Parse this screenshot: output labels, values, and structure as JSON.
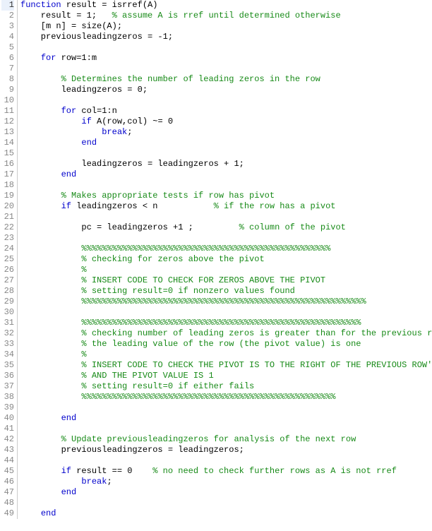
{
  "lines": [
    {
      "n": 1,
      "active": true,
      "seg": [
        {
          "t": "function",
          "c": "kw"
        },
        {
          "t": " result = isrref(A)",
          "c": "txt"
        }
      ]
    },
    {
      "n": 2,
      "seg": [
        {
          "t": "    result = 1;   ",
          "c": "txt"
        },
        {
          "t": "% assume A is rref until determined otherwise",
          "c": "com"
        }
      ]
    },
    {
      "n": 3,
      "seg": [
        {
          "t": "    [m n] = size(A);",
          "c": "txt"
        }
      ]
    },
    {
      "n": 4,
      "seg": [
        {
          "t": "    previousleadingzeros = -1;",
          "c": "txt"
        }
      ]
    },
    {
      "n": 5,
      "seg": [
        {
          "t": "",
          "c": "txt"
        }
      ]
    },
    {
      "n": 6,
      "seg": [
        {
          "t": "    ",
          "c": "txt"
        },
        {
          "t": "for",
          "c": "kw"
        },
        {
          "t": " row=1:m",
          "c": "txt"
        }
      ]
    },
    {
      "n": 7,
      "seg": [
        {
          "t": "",
          "c": "txt"
        }
      ]
    },
    {
      "n": 8,
      "seg": [
        {
          "t": "        ",
          "c": "txt"
        },
        {
          "t": "% Determines the number of leading zeros in the row",
          "c": "com"
        }
      ]
    },
    {
      "n": 9,
      "seg": [
        {
          "t": "        leadingzeros = 0;",
          "c": "txt"
        }
      ]
    },
    {
      "n": 10,
      "seg": [
        {
          "t": "",
          "c": "txt"
        }
      ]
    },
    {
      "n": 11,
      "seg": [
        {
          "t": "        ",
          "c": "txt"
        },
        {
          "t": "for",
          "c": "kw"
        },
        {
          "t": " col=1:n",
          "c": "txt"
        }
      ]
    },
    {
      "n": 12,
      "seg": [
        {
          "t": "            ",
          "c": "txt"
        },
        {
          "t": "if",
          "c": "kw"
        },
        {
          "t": " A(row,col) ~= 0",
          "c": "txt"
        }
      ]
    },
    {
      "n": 13,
      "seg": [
        {
          "t": "                ",
          "c": "txt"
        },
        {
          "t": "break",
          "c": "kw"
        },
        {
          "t": ";",
          "c": "txt"
        }
      ]
    },
    {
      "n": 14,
      "seg": [
        {
          "t": "            ",
          "c": "txt"
        },
        {
          "t": "end",
          "c": "kw"
        }
      ]
    },
    {
      "n": 15,
      "seg": [
        {
          "t": "",
          "c": "txt"
        }
      ]
    },
    {
      "n": 16,
      "seg": [
        {
          "t": "            leadingzeros = leadingzeros + 1;",
          "c": "txt"
        }
      ]
    },
    {
      "n": 17,
      "seg": [
        {
          "t": "        ",
          "c": "txt"
        },
        {
          "t": "end",
          "c": "kw"
        }
      ]
    },
    {
      "n": 18,
      "seg": [
        {
          "t": "",
          "c": "txt"
        }
      ]
    },
    {
      "n": 19,
      "seg": [
        {
          "t": "        ",
          "c": "txt"
        },
        {
          "t": "% Makes appropriate tests if row has pivot",
          "c": "com"
        }
      ]
    },
    {
      "n": 20,
      "seg": [
        {
          "t": "        ",
          "c": "txt"
        },
        {
          "t": "if",
          "c": "kw"
        },
        {
          "t": " leadingzeros < n           ",
          "c": "txt"
        },
        {
          "t": "% if the row has a pivot",
          "c": "com"
        }
      ]
    },
    {
      "n": 21,
      "seg": [
        {
          "t": "",
          "c": "txt"
        }
      ]
    },
    {
      "n": 22,
      "seg": [
        {
          "t": "            pc = leadingzeros +1 ;         ",
          "c": "txt"
        },
        {
          "t": "% column of the pivot",
          "c": "com"
        }
      ]
    },
    {
      "n": 23,
      "seg": [
        {
          "t": "",
          "c": "txt"
        }
      ]
    },
    {
      "n": 24,
      "seg": [
        {
          "t": "            ",
          "c": "txt"
        },
        {
          "t": "%%%%%%%%%%%%%%%%%%%%%%%%%%%%%%%%%%%%%%%%%%%%%%%%%",
          "c": "com"
        }
      ]
    },
    {
      "n": 25,
      "seg": [
        {
          "t": "            ",
          "c": "txt"
        },
        {
          "t": "% checking for zeros above the pivot",
          "c": "com"
        }
      ]
    },
    {
      "n": 26,
      "seg": [
        {
          "t": "            ",
          "c": "txt"
        },
        {
          "t": "%",
          "c": "com"
        }
      ]
    },
    {
      "n": 27,
      "seg": [
        {
          "t": "            ",
          "c": "txt"
        },
        {
          "t": "% INSERT CODE TO CHECK FOR ZEROS ABOVE THE PIVOT",
          "c": "com"
        }
      ]
    },
    {
      "n": 28,
      "seg": [
        {
          "t": "            ",
          "c": "txt"
        },
        {
          "t": "% setting result=0 if nonzero values found",
          "c": "com"
        }
      ]
    },
    {
      "n": 29,
      "seg": [
        {
          "t": "            ",
          "c": "txt"
        },
        {
          "t": "%%%%%%%%%%%%%%%%%%%%%%%%%%%%%%%%%%%%%%%%%%%%%%%%%%%%%%%%",
          "c": "com"
        }
      ]
    },
    {
      "n": 30,
      "seg": [
        {
          "t": "",
          "c": "txt"
        }
      ]
    },
    {
      "n": 31,
      "seg": [
        {
          "t": "            ",
          "c": "txt"
        },
        {
          "t": "%%%%%%%%%%%%%%%%%%%%%%%%%%%%%%%%%%%%%%%%%%%%%%%%%%%%%%%",
          "c": "com"
        }
      ]
    },
    {
      "n": 32,
      "seg": [
        {
          "t": "            ",
          "c": "txt"
        },
        {
          "t": "% checking number of leading zeros is greater than for the previous row and",
          "c": "com"
        }
      ]
    },
    {
      "n": 33,
      "seg": [
        {
          "t": "            ",
          "c": "txt"
        },
        {
          "t": "% the leading value of the row (the pivot value) is one",
          "c": "com"
        }
      ]
    },
    {
      "n": 34,
      "seg": [
        {
          "t": "            ",
          "c": "txt"
        },
        {
          "t": "%",
          "c": "com"
        }
      ]
    },
    {
      "n": 35,
      "seg": [
        {
          "t": "            ",
          "c": "txt"
        },
        {
          "t": "% INSERT CODE TO CHECK THE PIVOT IS TO THE RIGHT OF THE PREVIOUS ROW'S PIVOT",
          "c": "com"
        }
      ]
    },
    {
      "n": 36,
      "seg": [
        {
          "t": "            ",
          "c": "txt"
        },
        {
          "t": "% AND THE PIVOT VALUE IS 1",
          "c": "com"
        }
      ]
    },
    {
      "n": 37,
      "seg": [
        {
          "t": "            ",
          "c": "txt"
        },
        {
          "t": "% setting result=0 if either fails",
          "c": "com"
        }
      ]
    },
    {
      "n": 38,
      "seg": [
        {
          "t": "            ",
          "c": "txt"
        },
        {
          "t": "%%%%%%%%%%%%%%%%%%%%%%%%%%%%%%%%%%%%%%%%%%%%%%%%%%",
          "c": "com"
        }
      ]
    },
    {
      "n": 39,
      "seg": [
        {
          "t": "",
          "c": "txt"
        }
      ]
    },
    {
      "n": 40,
      "seg": [
        {
          "t": "        ",
          "c": "txt"
        },
        {
          "t": "end",
          "c": "kw"
        }
      ]
    },
    {
      "n": 41,
      "seg": [
        {
          "t": "",
          "c": "txt"
        }
      ]
    },
    {
      "n": 42,
      "seg": [
        {
          "t": "        ",
          "c": "txt"
        },
        {
          "t": "% Update previousleadingzeros for analysis of the next row",
          "c": "com"
        }
      ]
    },
    {
      "n": 43,
      "seg": [
        {
          "t": "        previousleadingzeros = leadingzeros;",
          "c": "txt"
        }
      ]
    },
    {
      "n": 44,
      "seg": [
        {
          "t": "",
          "c": "txt"
        }
      ]
    },
    {
      "n": 45,
      "seg": [
        {
          "t": "        ",
          "c": "txt"
        },
        {
          "t": "if",
          "c": "kw"
        },
        {
          "t": " result == 0    ",
          "c": "txt"
        },
        {
          "t": "% no need to check further rows as A is not rref",
          "c": "com"
        }
      ]
    },
    {
      "n": 46,
      "seg": [
        {
          "t": "            ",
          "c": "txt"
        },
        {
          "t": "break",
          "c": "kw"
        },
        {
          "t": ";",
          "c": "txt"
        }
      ]
    },
    {
      "n": 47,
      "seg": [
        {
          "t": "        ",
          "c": "txt"
        },
        {
          "t": "end",
          "c": "kw"
        }
      ]
    },
    {
      "n": 48,
      "seg": [
        {
          "t": "",
          "c": "txt"
        }
      ]
    },
    {
      "n": 49,
      "seg": [
        {
          "t": "    ",
          "c": "txt"
        },
        {
          "t": "end",
          "c": "kw"
        }
      ]
    }
  ]
}
